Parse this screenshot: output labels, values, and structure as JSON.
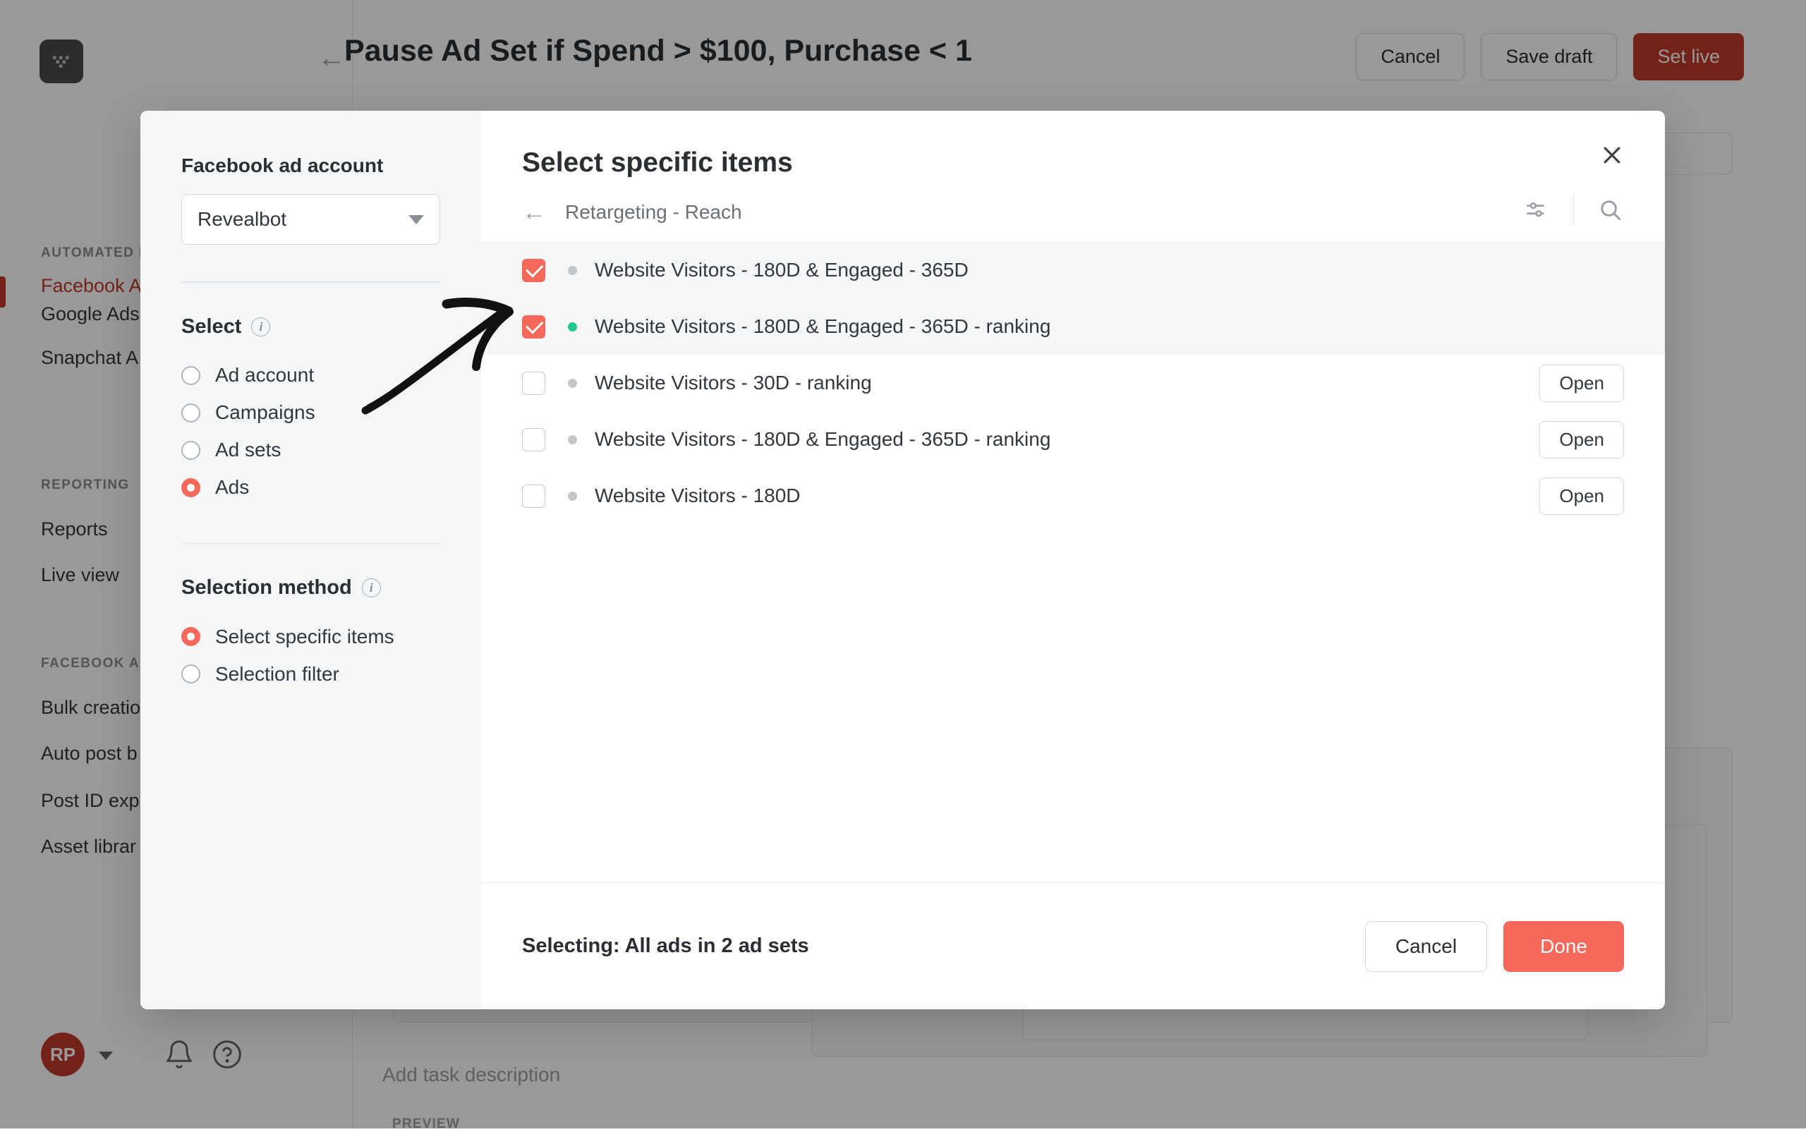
{
  "app": {
    "logo_icon": "revealbot-logo-icon",
    "topbar": {
      "back_icon": "back-arrow-icon",
      "title": "Pause Ad Set if Spend > $100, Purchase < 1",
      "buttons": [
        {
          "label": "Cancel",
          "style": "ghost"
        },
        {
          "label": "Save draft",
          "style": "ghost"
        },
        {
          "label": "Set live",
          "style": "primary"
        }
      ]
    },
    "sidebar": {
      "groups": [
        {
          "title": "AUTOMATED RU",
          "items": [
            {
              "label": "Facebook A",
              "active": true
            },
            {
              "label": "Google Ads",
              "active": false
            },
            {
              "label": "Snapchat A",
              "active": false
            }
          ]
        },
        {
          "title": "REPORTING",
          "items": [
            {
              "label": "Reports",
              "active": false
            },
            {
              "label": "Live view",
              "active": false
            }
          ]
        },
        {
          "title": "FACEBOOK ADS",
          "items": [
            {
              "label": "Bulk creatio",
              "active": false
            },
            {
              "label": "Auto post b",
              "active": false
            },
            {
              "label": "Post ID exp",
              "active": false
            },
            {
              "label": "Asset librar",
              "active": false
            }
          ]
        }
      ],
      "user": {
        "avatar_initials": "RP",
        "caret_icon": "chevron-down-icon",
        "bell_icon": "bell-icon",
        "help_icon": "help-circle-icon"
      }
    },
    "background_content": {
      "task_description_placeholder": "Add task description",
      "preview_label": "PREVIEW"
    }
  },
  "modal": {
    "close_icon": "close-icon",
    "left_panel": {
      "account_label": "Facebook ad account",
      "account_value": "Revealbot",
      "account_caret_icon": "chevron-down-icon",
      "select": {
        "title": "Select",
        "info_icon": "info-icon",
        "options": [
          {
            "label": "Ad account",
            "checked": false
          },
          {
            "label": "Campaigns",
            "checked": false
          },
          {
            "label": "Ad sets",
            "checked": false
          },
          {
            "label": "Ads",
            "checked": true
          }
        ]
      },
      "selection_method": {
        "title": "Selection method",
        "info_icon": "info-icon",
        "options": [
          {
            "label": "Select specific items",
            "checked": true
          },
          {
            "label": "Selection filter",
            "checked": false
          }
        ]
      }
    },
    "right_panel": {
      "title": "Select specific items",
      "breadcrumb": {
        "back_icon": "back-arrow-icon",
        "text": "Retargeting - Reach"
      },
      "tools": {
        "filter_icon": "sliders-icon",
        "search_icon": "search-icon"
      },
      "rows": [
        {
          "label": "Website Visitors - 180D & Engaged - 365D",
          "checked": true,
          "status": "grey",
          "selected": true,
          "open_label": ""
        },
        {
          "label": "Website Visitors - 180D & Engaged - 365D - ranking",
          "checked": true,
          "status": "green",
          "selected": true,
          "open_label": ""
        },
        {
          "label": "Website Visitors - 30D - ranking",
          "checked": false,
          "status": "grey",
          "selected": false,
          "open_label": "Open"
        },
        {
          "label": "Website Visitors - 180D & Engaged - 365D - ranking",
          "checked": false,
          "status": "grey",
          "selected": false,
          "open_label": "Open"
        },
        {
          "label": "Website Visitors - 180D",
          "checked": false,
          "status": "grey",
          "selected": false,
          "open_label": "Open"
        }
      ],
      "footer": {
        "status_text": "Selecting: All ads in 2 ad sets",
        "cancel_label": "Cancel",
        "done_label": "Done"
      }
    }
  },
  "colors": {
    "accent_coral": "#f4695a",
    "accent_brand_red": "#c0392b",
    "status_green": "#1ec98e",
    "status_grey": "#c3c7cb"
  }
}
